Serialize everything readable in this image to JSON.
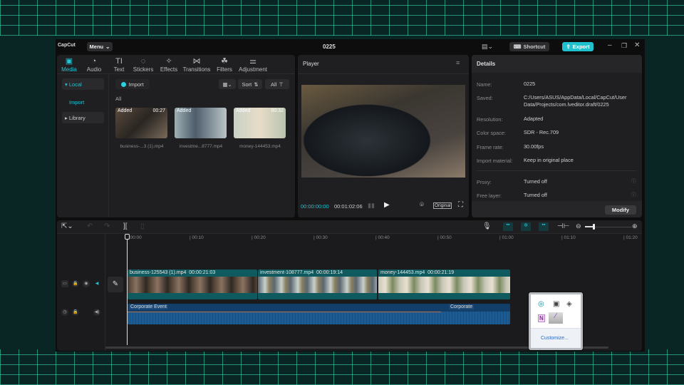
{
  "app": {
    "logo": "CapCut",
    "menu_label": "Menu",
    "project_title": "0225",
    "shortcut_label": "Shortcut",
    "export_label": "Export"
  },
  "media_tabs": [
    {
      "label": "Media",
      "icon": "media-icon"
    },
    {
      "label": "Audio",
      "icon": "audio-icon"
    },
    {
      "label": "Text",
      "icon": "text-icon",
      "glyph": "TI"
    },
    {
      "label": "Stickers",
      "icon": "sticker-icon"
    },
    {
      "label": "Effects",
      "icon": "effects-icon"
    },
    {
      "label": "Transitions",
      "icon": "transitions-icon"
    },
    {
      "label": "Filters",
      "icon": "filters-icon"
    },
    {
      "label": "Adjustment",
      "icon": "adjustment-icon"
    }
  ],
  "sidebar": {
    "local": "Local",
    "import": "Import",
    "library": "Library"
  },
  "media": {
    "import_label": "Import",
    "sort_label": "Sort",
    "all_filter": "All",
    "section_label": "All",
    "items": [
      {
        "badge": "Added",
        "duration": "00:27",
        "name": "business-...3 (1).mp4"
      },
      {
        "badge": "Added",
        "duration": "",
        "name": "investme...8777.mp4"
      },
      {
        "badge": "Added",
        "duration": "00:32",
        "name": "money-144453.mp4"
      }
    ]
  },
  "player": {
    "title": "Player",
    "current_time": "00:00:00:00",
    "total_time": "00:01:02:06",
    "ratio_label": "Original"
  },
  "details": {
    "title": "Details",
    "rows": [
      {
        "label": "Name:",
        "value": "0225"
      },
      {
        "label": "Saved:",
        "value": "C:/Users/ASUS/AppData/Local/CapCut/User Data/Projects/com.lveditor.draft/0225"
      },
      {
        "label": "Resolution:",
        "value": "Adapted"
      },
      {
        "label": "Color space:",
        "value": "SDR - Rec.709"
      },
      {
        "label": "Frame rate:",
        "value": "30.00fps"
      },
      {
        "label": "Import material:",
        "value": "Keep in original place"
      }
    ],
    "extra": [
      {
        "label": "Proxy:",
        "value": "Turned off"
      },
      {
        "label": "Free layer:",
        "value": "Turned off"
      }
    ],
    "modify_label": "Modify"
  },
  "timeline": {
    "ticks": [
      "00:00",
      "00:10",
      "00:20",
      "00:30",
      "00:40",
      "00:50",
      "01:00",
      "01:10",
      "01:20"
    ],
    "clips": [
      {
        "name": "business-125543 (1).mp4",
        "duration": "00:00:21:03"
      },
      {
        "name": "investment-108777.mp4",
        "duration": "00:00:19:14"
      },
      {
        "name": "money-144453.mp4",
        "duration": "00:00:21:19"
      }
    ],
    "audio": [
      {
        "name": "Corporate Event"
      },
      {
        "name": "Corporate"
      }
    ],
    "zoom_level": 0.1
  },
  "tray_popup": {
    "customize_label": "Customize..."
  },
  "colors": {
    "accent": "#22c3d3",
    "clip": "#0f5a5e",
    "audio": "#123e6a"
  }
}
